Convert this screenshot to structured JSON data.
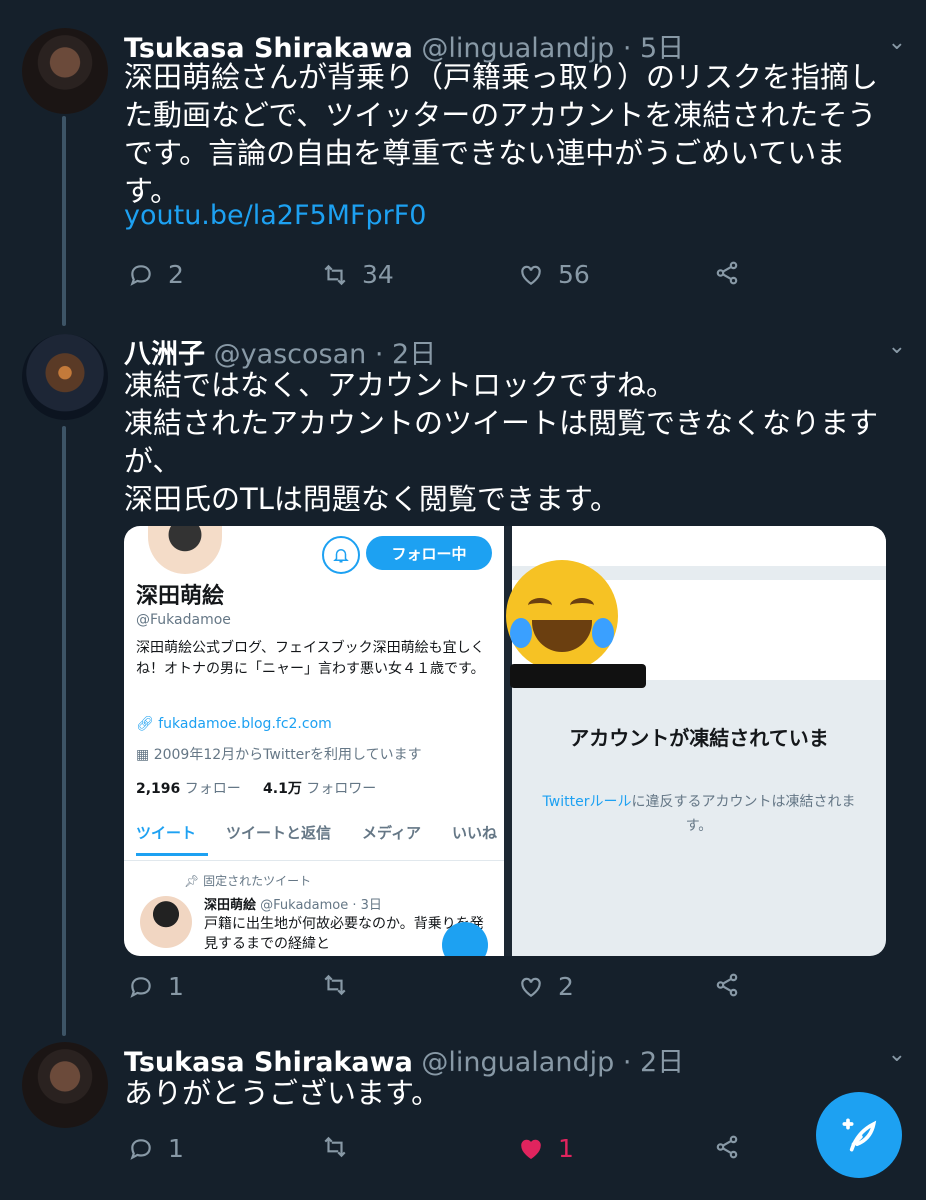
{
  "tweets": [
    {
      "name": "Tsukasa Shirakawa",
      "handle": "@lingualandjp",
      "sep": " · ",
      "time": "5日",
      "text": "深田萌絵さんが背乗り（戸籍乗っ取り）のリスクを指摘した動画などで、ツイッターのアカウントを凍結されたそうです。言論の自由を尊重できない連中がうごめいています。",
      "link": "youtu.be/la2F5MFprF0",
      "replies": "2",
      "retweets": "34",
      "likes": "56"
    },
    {
      "name": "八洲子",
      "handle": "@yascosan",
      "sep": " · ",
      "time": "2日",
      "lines": [
        "凍結ではなく、アカウントロックですね。",
        "凍結されたアカウントのツイートは閲覧できなくなります",
        "が、",
        "深田氏のTLは問題なく閲覧できます。"
      ],
      "replies": "1",
      "retweets": "",
      "likes": "2"
    },
    {
      "name": "Tsukasa Shirakawa",
      "handle": "@lingualandjp",
      "sep": " · ",
      "time": "2日",
      "text": "ありがとうございます。",
      "replies": "1",
      "retweets": "",
      "likes": "1"
    }
  ],
  "profile": {
    "follow_label": "フォロー中",
    "name": "深田萌絵",
    "handle": "@Fukadamoe",
    "bio": "深田萌絵公式ブログ、フェイスブック深田萌絵も宜しくね！オトナの男に「ニャー」言わす悪い女４１歳です。",
    "url": "fukadamoe.blog.fc2.com",
    "joined": "2009年12月からTwitterを利用しています",
    "following_count": "2,196",
    "following_label": "フォロー",
    "followers_count": "4.1万",
    "followers_label": "フォロワー",
    "tabs": [
      "ツイート",
      "ツイートと返信",
      "メディア",
      "いいね"
    ],
    "pinned_label": "固定されたツイート",
    "pinned_name": "深田萌絵",
    "pinned_handle": "@Fukadamoe · 3日",
    "pinned_text": "戸籍に出生地が何故必要なのか。背乗りを発見するまでの経緯と"
  },
  "suspended": {
    "title": "アカウントが凍結されていま",
    "rules_link": "Twitterルール",
    "body": "に違反するアカウントは凍結されます。"
  },
  "colors": {
    "bg": "#15202b",
    "accent": "#1da1f2",
    "muted": "#8899a6",
    "like": "#e0245e"
  }
}
